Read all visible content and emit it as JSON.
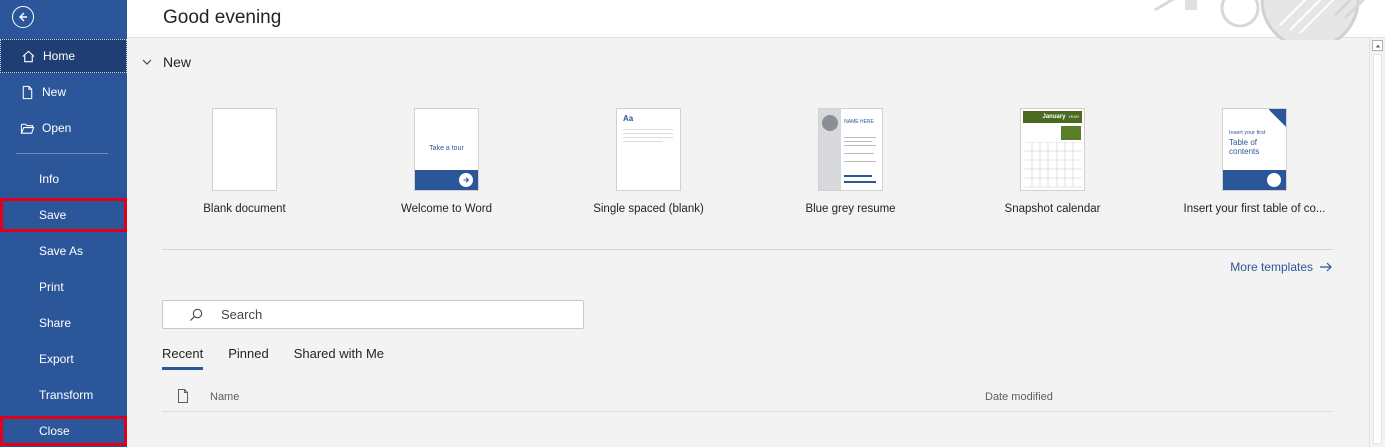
{
  "header": {
    "greeting": "Good evening"
  },
  "sidebar": {
    "items": [
      {
        "label": "Home"
      },
      {
        "label": "New"
      },
      {
        "label": "Open"
      },
      {
        "label": "Info"
      },
      {
        "label": "Save"
      },
      {
        "label": "Save As"
      },
      {
        "label": "Print"
      },
      {
        "label": "Share"
      },
      {
        "label": "Export"
      },
      {
        "label": "Transform"
      },
      {
        "label": "Close"
      }
    ]
  },
  "new_section": {
    "title": "New",
    "templates": [
      {
        "label": "Blank document"
      },
      {
        "label": "Welcome to Word",
        "thumb_text": "Take a tour"
      },
      {
        "label": "Single spaced (blank)",
        "thumb_text": "Aa"
      },
      {
        "label": "Blue grey resume",
        "thumb_text": "NAME HERE"
      },
      {
        "label": "Snapshot calendar",
        "thumb_text": "January",
        "thumb_year": "YEAR"
      },
      {
        "label": "Insert your first table of co...",
        "thumb_text_1": "Insert your first",
        "thumb_text_2": "Table of contents"
      }
    ],
    "more_templates": "More templates"
  },
  "search": {
    "placeholder": "Search"
  },
  "recent": {
    "tabs": [
      "Recent",
      "Pinned",
      "Shared with Me"
    ],
    "columns": {
      "name": "Name",
      "date": "Date modified"
    }
  },
  "colors": {
    "accent": "#2b579a",
    "highlight": "#e0001b"
  }
}
